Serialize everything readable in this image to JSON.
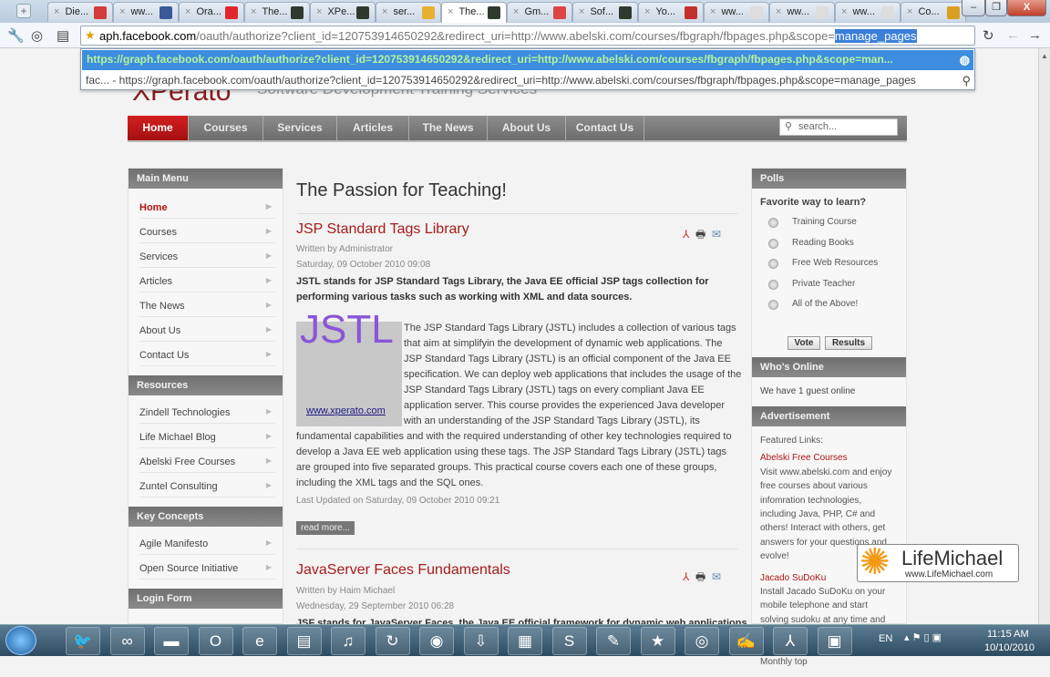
{
  "browser": {
    "tabs": [
      "Die...",
      "ww...",
      "Ora...",
      "The...",
      "XPe...",
      "ser...",
      "The...",
      "Gm...",
      "Sof...",
      "Yo...",
      "ww...",
      "ww...",
      "ww...",
      "Co..."
    ],
    "active_tab": 6,
    "tab_colors": [
      "#d43b3b",
      "#3b5998",
      "#e0282c",
      "#2d3a2d",
      "#2d3a2d",
      "#e8b030",
      "#2d3a2d",
      "#d44",
      "#2d3a2d",
      "#c4302b",
      "#ddd",
      "#ddd",
      "#ddd",
      "#d9a020"
    ],
    "address": {
      "host": "aph.facebook.com",
      "rest": "/oauth/authorize?client_id=120753914650292&redirect_uri=http://www.abelski.com/courses/fbgraph/fbpages.php&scope=",
      "selected": "manage_pages"
    },
    "suggestions": [
      {
        "text": "https://graph.facebook.com/oauth/authorize?client_id=120753914650292&redirect_uri=http://www.abelski.com/courses/fbgraph/fbpages.php&scope=man...",
        "icon": "globe-icon"
      },
      {
        "text": "fac... - https://graph.facebook.com/oauth/authorize?client_id=120753914650292&redirect_uri=http://www.abelski.com/courses/fbgraph/fbpages.php&scope=manage_pages",
        "icon": "search-icon"
      }
    ]
  },
  "site": {
    "logo": "XPerato",
    "slogan": "Software Development Training Services",
    "nav": [
      "Home",
      "Courses",
      "Services",
      "Articles",
      "The News",
      "About Us",
      "Contact Us"
    ],
    "search_placeholder": "search...",
    "accent": "#b01515",
    "left": {
      "main_menu": {
        "title": "Main Menu",
        "items": [
          "Home",
          "Courses",
          "Services",
          "Articles",
          "The News",
          "About Us",
          "Contact Us"
        ]
      },
      "resources": {
        "title": "Resources",
        "items": [
          "Zindell Technologies",
          "Life Michael Blog",
          "Abelski Free Courses",
          "Zuntel Consulting"
        ]
      },
      "key_concepts": {
        "title": "Key Concepts",
        "items": [
          "Agile Manifesto",
          "Open Source Initiative"
        ]
      },
      "login": {
        "title": "Login Form"
      }
    },
    "main": {
      "heading": "The Passion for Teaching!",
      "articles": [
        {
          "title": "JSP Standard Tags Library",
          "author": "Written by Administrator",
          "date": "Saturday, 09 October 2010 09:08",
          "intro": "JSTL stands for JSP Standard Tags Library, the Java EE official JSP tags collection for performing various tasks such as working with XML and data sources.",
          "image_text": "JSTL",
          "image_link": "www.xperato.com",
          "body": "The JSP Standard Tags Library (JSTL) includes a collection of various tags that aim at simplifyin the development of dynamic web applications. The JSP Standard Tags Library (JSTL) is an official component of the Java EE specification. We can deploy web applications that includes the usage of the JSP Standard Tags Library (JSTL) tags on every compliant Java EE application server. This course provides the experienced Java developer with an understanding of the JSP Standard Tags Library (JSTL), its fundamental capabilities and with the required understanding of other key technologies required to develop a Java EE web application using these tags. The JSP Standard Tags Library (JSTL) tags are grouped into five separated groups. This practical course covers each one of these groups, including the XML tags and the SQL ones.",
          "updated": "Last Updated on Saturday, 09 October 2010 09:21",
          "read_more": "read more..."
        },
        {
          "title": "JavaServer Faces Fundamentals",
          "author": "Written by Haim Michael",
          "date": "Wednesday, 29 September 2010 06:28",
          "intro": "JSF stands for JavaServer Faces, the Java EE official framework for dynamic web applications"
        }
      ]
    },
    "right": {
      "polls": {
        "title": "Polls",
        "question": "Favorite way to learn?",
        "options": [
          "Training Course",
          "Reading Books",
          "Free Web Resources",
          "Private Teacher",
          "All of the Above!"
        ],
        "vote": "Vote",
        "results": "Results"
      },
      "online": {
        "title": "Who's Online",
        "text": "We have 1 guest online"
      },
      "ad": {
        "title": "Advertisement",
        "featured": "Featured Links:",
        "links": [
          {
            "title": "Abelski Free Courses",
            "text": "Visit www.abelski.com and enjoy free courses about various infomration technologies, including Java, PHP, C# and others! Interact with others, get answers for your questions and evolve!"
          },
          {
            "title": "Jacado SuDoKu",
            "text": "Install Jacado SuDoKu on your mobile telephone and start solving sudoku at any time and wherever you go. Each day three new sudokus are available. Monthly top"
          }
        ]
      }
    }
  },
  "overlay": {
    "name": "LifeMichael",
    "url": "www.LifeMichael.com"
  },
  "taskbar": {
    "language": "EN",
    "time": "11:15 AM",
    "date": "10/10/2010"
  }
}
